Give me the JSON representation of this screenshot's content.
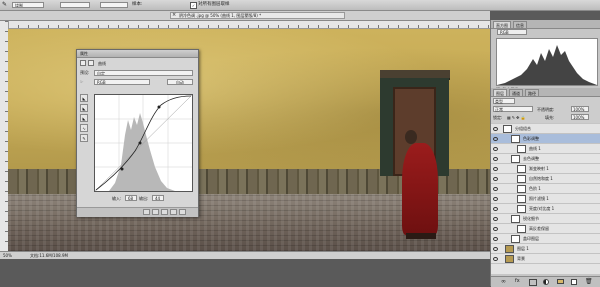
{
  "options_bar": {
    "tool_preset": "烧制",
    "sample_label": "样本:",
    "checkbox_label": "对所有图层取样",
    "tool_icon": "eyedropper-icon"
  },
  "document": {
    "title": "阴冷色调 .jpg @ 50% (曲线 1, 图层蒙版/8) *",
    "zoom": "50%",
    "doc_size": "文档:11.6M/108.9M"
  },
  "curves_panel": {
    "title": "属性",
    "panel_name": "曲线",
    "preset_label": "预设:",
    "preset_value": "自定",
    "channel_value": "RGB",
    "auto_button": "自动",
    "input_label": "输入:",
    "input_value": "68",
    "output_label": "输出:",
    "output_value": "44",
    "tools": [
      "sample-shadow-icon",
      "sample-midtone-icon",
      "sample-highlight-icon",
      "curve-pencil-icon",
      "smooth-icon"
    ]
  },
  "histogram_panel": {
    "tabs": [
      "直方图",
      "信息"
    ],
    "source": "通道:",
    "source_value": "RGB",
    "footer": "源: 整个图像"
  },
  "layers_panel": {
    "tabs": [
      "图层",
      "通道",
      "路径"
    ],
    "filter_label": "类型",
    "blend_mode": "正常",
    "opacity_label": "不透明度:",
    "opacity_value": "100%",
    "lock_label": "锁定:",
    "fill_label": "填充:",
    "fill_value": "100%",
    "layers": [
      {
        "name": "分组组合",
        "selected": false
      },
      {
        "name": "色彩调整",
        "selected": true
      },
      {
        "name": "曲线 1",
        "selected": false
      },
      {
        "name": "去色调整",
        "selected": false
      },
      {
        "name": "渐变映射 1",
        "selected": false
      },
      {
        "name": "自然饱和度 1",
        "selected": false
      },
      {
        "name": "色阶 1",
        "selected": false
      },
      {
        "name": "照片滤镜 1",
        "selected": false
      },
      {
        "name": "亮度/对比度 1",
        "selected": false
      },
      {
        "name": "锐化细节",
        "selected": false
      },
      {
        "name": "高反差保留",
        "selected": false
      },
      {
        "name": "盖印图层",
        "selected": false
      },
      {
        "name": "图层 1",
        "selected": false
      },
      {
        "name": "背景",
        "selected": false
      }
    ]
  }
}
